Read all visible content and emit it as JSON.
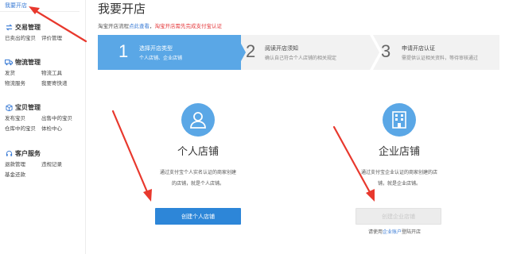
{
  "sidebar": {
    "top_link": "我要开店",
    "groups": [
      {
        "title": "交易管理",
        "icon": "exchange-icon",
        "items": [
          [
            "已卖出的宝贝",
            "评价管理"
          ]
        ]
      },
      {
        "title": "物流管理",
        "icon": "truck-icon",
        "items": [
          [
            "发货",
            "物流工具"
          ],
          [
            "物流服务",
            "我要寄快递"
          ]
        ]
      },
      {
        "title": "宝贝管理",
        "icon": "box-icon",
        "items": [
          [
            "发布宝贝",
            "出售中的宝贝"
          ],
          [
            "仓库中的宝贝",
            "体检中心"
          ]
        ]
      },
      {
        "title": "客户服务",
        "icon": "headset-icon",
        "items": [
          [
            "退款管理",
            "违规记录"
          ],
          [
            "基金还款",
            ""
          ]
        ]
      }
    ]
  },
  "main": {
    "title": "我要开店",
    "crumb": {
      "prefix": "淘宝开店流程",
      "link": "点此查看",
      "sep": "，",
      "warning": "淘宝开店需先完成支付宝认证"
    },
    "steps": [
      {
        "num": "1",
        "title": "选择开店类型",
        "desc": "个人店铺、企业店铺"
      },
      {
        "num": "2",
        "title": "阅读开店须知",
        "desc": "确认自己符合个人店铺的相关规定"
      },
      {
        "num": "3",
        "title": "申请开店认证",
        "desc": "需提供认证相关资料，等待审核通过"
      }
    ],
    "personal": {
      "icon": "person-icon",
      "title": "个人店铺",
      "desc_line1": "通过支付宝个人实名认证的商家创建",
      "desc_line2": "的店铺，就是个人店铺。",
      "button": "创建个人店铺"
    },
    "company": {
      "icon": "building-icon",
      "title": "企业店铺",
      "desc_line1": "通过支付宝企业认证的商家创建的店",
      "desc_line2": "铺，就是企业店铺。",
      "button": "创建企业店铺",
      "hint_prefix": "请使用",
      "hint_link": "企业账户",
      "hint_suffix": "登陆开店"
    }
  },
  "colors": {
    "accent": "#5aa7e6",
    "primary_button": "#2d86d8",
    "link": "#3a7bd5",
    "warning": "#e4393c",
    "annotation_arrow": "#e8382d"
  }
}
